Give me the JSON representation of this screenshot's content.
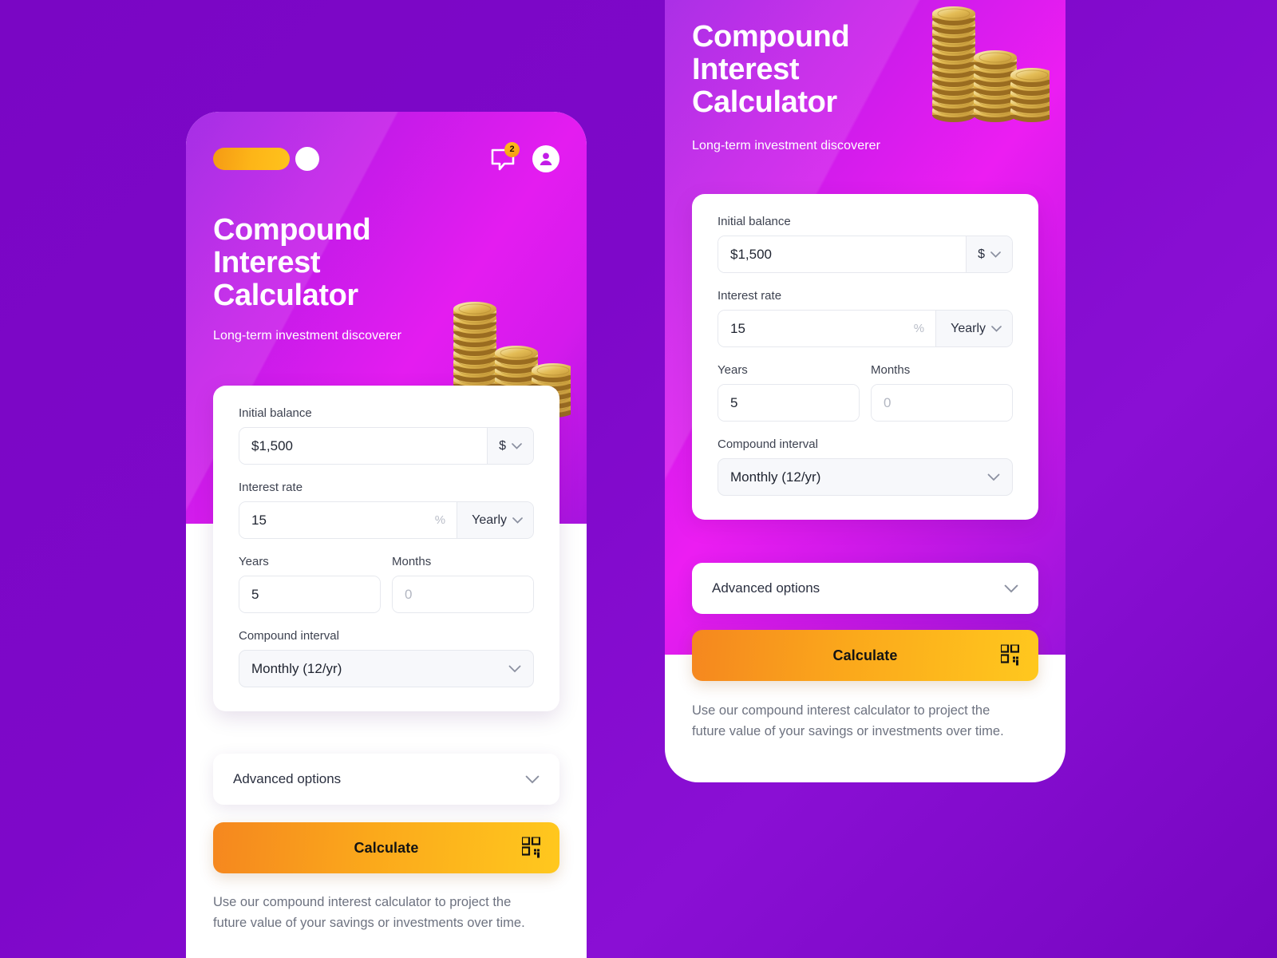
{
  "theme": {
    "background_purple": "#7A06C4",
    "hero_magenta": "#E41CF0",
    "accent_orange": "#FBA81B",
    "button_gradient_start": "#F5871F",
    "button_gradient_end": "#FFC81E"
  },
  "topbar": {
    "notification_count": "2",
    "chat_icon": "chat-bubble-icon",
    "avatar_icon": "user-avatar-icon",
    "brand_pill": "brand-pill-logo",
    "brand_dot": "brand-dot-logo"
  },
  "hero": {
    "title": "Compound\nInterest\nCalculator",
    "subtitle": "Long-term investment discoverer",
    "illustration": "gold-coin-stacks"
  },
  "form": {
    "initial_balance": {
      "label": "Initial balance",
      "value": "$1,500",
      "currency": "$",
      "currency_icon": "chevron-down-icon"
    },
    "interest_rate": {
      "label": "Interest rate",
      "value": "15",
      "unit": "%",
      "period": "Yearly",
      "period_icon": "chevron-down-icon"
    },
    "years": {
      "label": "Years",
      "value": "5"
    },
    "months": {
      "label": "Months",
      "placeholder": "0",
      "value": ""
    },
    "compound_interval": {
      "label": "Compound interval",
      "value": "Monthly (12/yr)",
      "icon": "chevron-down-icon"
    }
  },
  "advanced": {
    "label": "Advanced options",
    "icon": "chevron-down-icon"
  },
  "calculate": {
    "label": "Calculate",
    "icon": "qr-code-icon"
  },
  "footer": {
    "note": "Use our compound interest calculator to project the future value of your savings or investments over time."
  }
}
